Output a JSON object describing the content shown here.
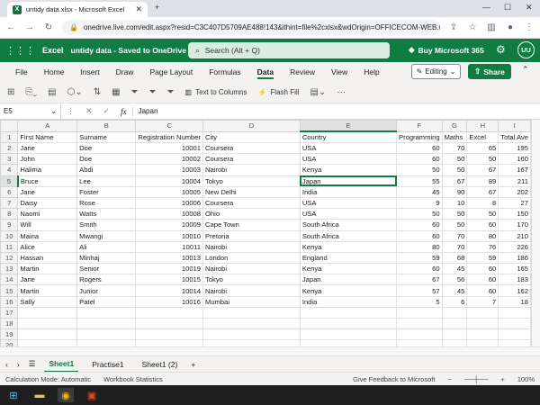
{
  "browser": {
    "tab_title": "untidy data.xlsx - Microsoft Excel",
    "address": "onedrive.live.com/edit.aspx?resid=C3C407D5709AE488!143&ithint=file%2cxlsx&wdOrigin=OFFICECOM-WEB.M..."
  },
  "excel": {
    "brand": "Excel",
    "doc_title": "untidy data - Saved to OneDrive ⌄",
    "search_placeholder": "Search (Alt + Q)",
    "buy_label": "Buy Microsoft 365",
    "avatar_initials": "UU",
    "accent": "#107c41"
  },
  "menu": {
    "items": [
      "File",
      "Home",
      "Insert",
      "Draw",
      "Page Layout",
      "Formulas",
      "Data",
      "Review",
      "View",
      "Help"
    ],
    "active": "Data",
    "editing_label": "Editing",
    "share_label": "Share"
  },
  "toolbar": {
    "text_to_columns": "Text to Columns",
    "flash_fill": "Flash Fill"
  },
  "formula_bar": {
    "cell_ref": "E5",
    "value": "Japan"
  },
  "grid": {
    "columns": [
      "A",
      "B",
      "C",
      "D",
      "E",
      "F",
      "G",
      "H",
      "I"
    ],
    "row_numbers": [
      "1",
      "2",
      "3",
      "4",
      "5",
      "6",
      "7",
      "8",
      "9",
      "10",
      "11",
      "12",
      "13",
      "14",
      "15",
      "16",
      "17",
      "18",
      "19",
      "20"
    ],
    "rows": [
      [
        "First Name",
        "Surname",
        "Registration Number",
        "City",
        "Country",
        "Programming",
        "Maths",
        "Excel",
        "Total Ave"
      ],
      [
        "Jane",
        "Doe",
        "10001",
        "Coursera",
        "USA",
        "60",
        "70",
        "65",
        "195"
      ],
      [
        "John",
        "Doe",
        "10002",
        "Coursera",
        "USA",
        "60",
        "50",
        "50",
        "160"
      ],
      [
        "Halima",
        "Abdi",
        "10003",
        "Nairobi",
        "Kenya",
        "50",
        "50",
        "67",
        "167"
      ],
      [
        "Bruce",
        "Lee",
        "10004",
        "Tokyo",
        "Japan",
        "55",
        "67",
        "89",
        "211"
      ],
      [
        "Jane",
        "Foster",
        "10005",
        "New Delhi",
        "India",
        "45",
        "90",
        "67",
        "202"
      ],
      [
        "Daisy",
        "Rose",
        "10006",
        "Coursera",
        "USA",
        "9",
        "10",
        "8",
        "27"
      ],
      [
        "Naomi",
        "Watts",
        "10008",
        "Ohio",
        "USA",
        "50",
        "50",
        "50",
        "150"
      ],
      [
        "Will",
        "Smith",
        "10009",
        "Cape Town",
        "South Africa",
        "60",
        "50",
        "60",
        "170"
      ],
      [
        "Maina",
        "Mwangi",
        "10010",
        "Pretoria",
        "South Africa",
        "60",
        "70",
        "80",
        "210"
      ],
      [
        "Alice",
        "Ali",
        "10011",
        "Nairobi",
        "Kenya",
        "80",
        "70",
        "76",
        "226"
      ],
      [
        "Hassan",
        "Minhaj",
        "10013",
        "London",
        "England",
        "59",
        "68",
        "59",
        "186"
      ],
      [
        "Martin",
        "Senior",
        "10019",
        "Nairobi",
        "Kenya",
        "60",
        "45",
        "60",
        "165"
      ],
      [
        "Jane",
        "Rogers",
        "10015",
        "Tokyo",
        "Japan",
        "67",
        "56",
        "60",
        "183"
      ],
      [
        "Martin",
        "Junior",
        "10014",
        "Nairobi",
        "Kenya",
        "57",
        "45",
        "60",
        "162"
      ],
      [
        "Sally",
        "Patel",
        "10016",
        "Mumbai",
        "India",
        "5",
        "6",
        "7",
        "18"
      ],
      [
        "",
        "",
        "",
        "",
        "",
        "",
        "",
        "",
        ""
      ],
      [
        "",
        "",
        "",
        "",
        "",
        "",
        "",
        "",
        ""
      ],
      [
        "",
        "",
        "",
        "",
        "",
        "",
        "",
        "",
        ""
      ],
      [
        "",
        "",
        "",
        "",
        "",
        "",
        "",
        "",
        ""
      ]
    ]
  },
  "sheets": {
    "tabs": [
      "Sheet1",
      "Practise1",
      "Sheet1 (2)"
    ],
    "active": "Sheet1"
  },
  "status": {
    "calc_mode": "Calculation Mode: Automatic",
    "workbook_stats": "Workbook Statistics",
    "feedback": "Give Feedback to Microsoft",
    "zoom": "100%"
  }
}
